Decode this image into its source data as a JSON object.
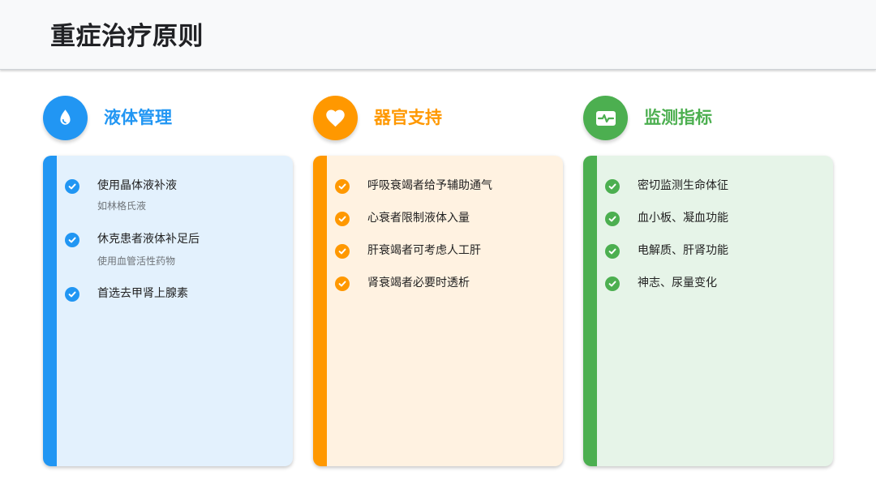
{
  "title": "重症治疗原则",
  "sections": [
    {
      "title": "液体管理",
      "icon": "water-drop-icon",
      "color": "#2196f3",
      "items": [
        {
          "label": "使用晶体液补液",
          "subtext": "如林格氏液"
        },
        {
          "label": "休克患者液体补足后",
          "subtext": "使用血管活性药物"
        },
        {
          "label": "首选去甲肾上腺素"
        }
      ]
    },
    {
      "title": "器官支持",
      "icon": "heart-icon",
      "color": "#ff9800",
      "items": [
        {
          "label": "呼吸衰竭者给予辅助通气"
        },
        {
          "label": "心衰者限制液体入量"
        },
        {
          "label": "肝衰竭者可考虑人工肝"
        },
        {
          "label": "肾衰竭者必要时透析"
        }
      ]
    },
    {
      "title": "监测指标",
      "icon": "heart-monitor-icon",
      "color": "#4caf50",
      "items": [
        {
          "label": "密切监测生命体征"
        },
        {
          "label": "血小板、凝血功能"
        },
        {
          "label": "电解质、肝肾功能"
        },
        {
          "label": "神志、尿量变化"
        }
      ]
    }
  ]
}
